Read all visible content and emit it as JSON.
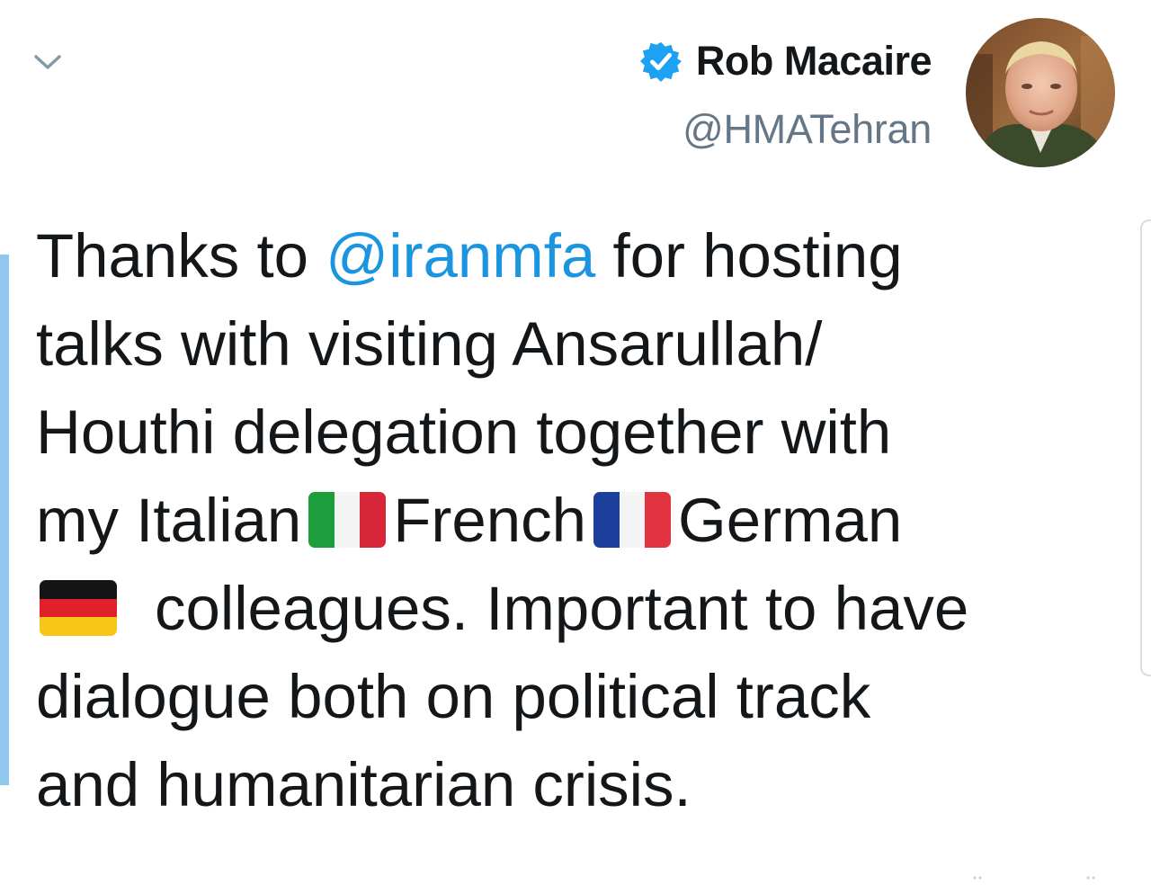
{
  "author": {
    "display_name": "Rob Macaire",
    "handle": "@HMATehran",
    "verified_icon": "verified-badge-icon",
    "avatar": "profile-photo"
  },
  "menu": {
    "icon": "chevron-down-icon"
  },
  "tweet": {
    "line1_pre": "Thanks to ",
    "mention": "@iranmfa",
    "line1_post": " for hosting",
    "line2": "talks with visiting Ansarullah/",
    "line3": "Houthi delegation together with",
    "line4_a": "my Italian",
    "line4_b": "French",
    "line4_c": "German",
    "line5": "colleagues.  Important to have",
    "line6": "dialogue both on political track",
    "line7": "and humanitarian crisis.",
    "flags": [
      "italy-flag-icon",
      "france-flag-icon",
      "germany-flag-icon"
    ]
  },
  "colors": {
    "mention": "#1b95e0",
    "text": "#14171a",
    "handle": "#657786",
    "verified": "#1da1f2",
    "accent_bar": "#8fc7ee"
  }
}
